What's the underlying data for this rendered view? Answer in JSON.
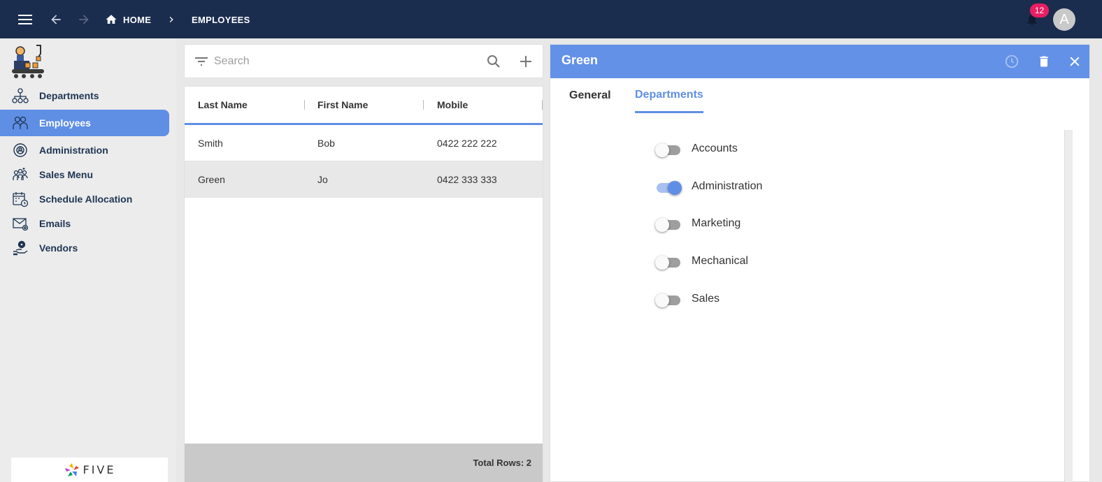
{
  "topbar": {
    "home_label": "HOME",
    "current_label": "EMPLOYEES",
    "notification_count": "12",
    "avatar_initial": "A"
  },
  "sidebar": {
    "items": [
      {
        "label": "Departments",
        "icon": "departments-icon",
        "active": false
      },
      {
        "label": "Employees",
        "icon": "employees-icon",
        "active": true
      },
      {
        "label": "Administration",
        "icon": "administration-icon",
        "active": false
      },
      {
        "label": "Sales Menu",
        "icon": "sales-menu-icon",
        "active": false
      },
      {
        "label": "Schedule Allocation",
        "icon": "schedule-icon",
        "active": false
      },
      {
        "label": "Emails",
        "icon": "emails-icon",
        "active": false
      },
      {
        "label": "Vendors",
        "icon": "vendors-icon",
        "active": false
      }
    ],
    "footer_logo_text": "FIVE"
  },
  "list": {
    "search_placeholder": "Search",
    "columns": [
      "Last Name",
      "First Name",
      "Mobile"
    ],
    "rows": [
      [
        "Smith",
        "Bob",
        "0422 222 222"
      ],
      [
        "Green",
        "Jo",
        "0422 333 333"
      ]
    ],
    "selected_row": 1,
    "total_rows_label": "Total Rows: 2"
  },
  "detail": {
    "title": "Green",
    "tabs": [
      {
        "label": "General",
        "active": false
      },
      {
        "label": "Departments",
        "active": true
      }
    ],
    "departments": [
      {
        "label": "Accounts",
        "checked": false
      },
      {
        "label": "Administration",
        "checked": true
      },
      {
        "label": "Marketing",
        "checked": false
      },
      {
        "label": "Mechanical",
        "checked": false
      },
      {
        "label": "Sales",
        "checked": false
      }
    ]
  },
  "colors": {
    "topbar_bg": "#1b2d4f",
    "accent": "#5f8fe5",
    "detail_header": "#6391e8",
    "badge": "#e91e63"
  }
}
